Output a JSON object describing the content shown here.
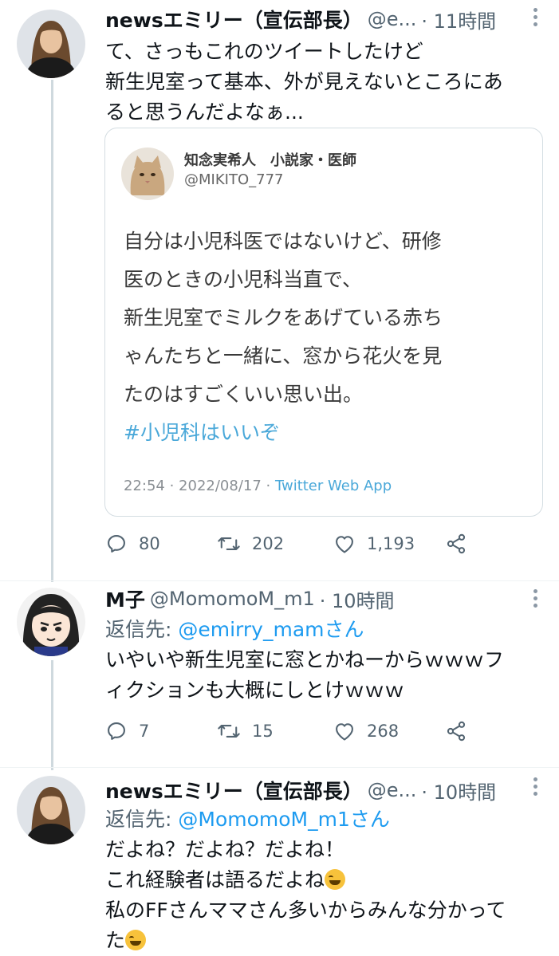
{
  "tweet1": {
    "name": "newsエミリー（宣伝部長）",
    "handle": "@e...",
    "time": "· 11時間",
    "text_lines": [
      "て、さっもこれのツイートしたけど",
      "新生児室って基本、外が見えないところにあ",
      "ると思うんだよなぁ..."
    ],
    "quote": {
      "name": "知念実希人　小説家・医師",
      "handle": "@MIKITO_777",
      "text_lines": [
        "自分は小児科医ではないけど、研修",
        "医のときの小児科当直で、",
        "新生児室でミルクをあげている赤ち",
        "ゃんたちと一緒に、窓から花火を見",
        "たのはすごくいい思い出。"
      ],
      "hashtag": "#小児科はいいぞ",
      "footer_time": "22:54 · 2022/08/17 · ",
      "footer_app": "Twitter Web App"
    },
    "actions": {
      "replies": "80",
      "retweets": "202",
      "likes": "1,193"
    }
  },
  "tweet2": {
    "name": "M子",
    "handle": "@MomomoM_m1",
    "time": "· 10時間",
    "reply_prefix": "返信先: ",
    "reply_target": "@emirry_mamさん",
    "text_lines": [
      "いやいや新生児室に窓とかねーからｗｗｗフ",
      "ィクションも大概にしとけｗｗｗ"
    ],
    "actions": {
      "replies": "7",
      "retweets": "15",
      "likes": "268"
    }
  },
  "tweet3": {
    "name": "newsエミリー（宣伝部長）",
    "handle": "@e...",
    "time": "· 10時間",
    "reply_prefix": "返信先: ",
    "reply_target": "@MomomoM_m1さん",
    "text_lines": [
      "だよね？だよね？だよね！",
      "これ経験者は語るだよね",
      "私のFFさんママさん多いからみんな分かって",
      "た"
    ]
  },
  "icons": {
    "reply": "reply-icon",
    "retweet": "retweet-icon",
    "like": "heart-icon",
    "share": "share-icon",
    "more": "more-icon"
  },
  "colors": {
    "link": "#1d9bf0",
    "muted": "#536471",
    "thread_line": "#cfd9de"
  }
}
